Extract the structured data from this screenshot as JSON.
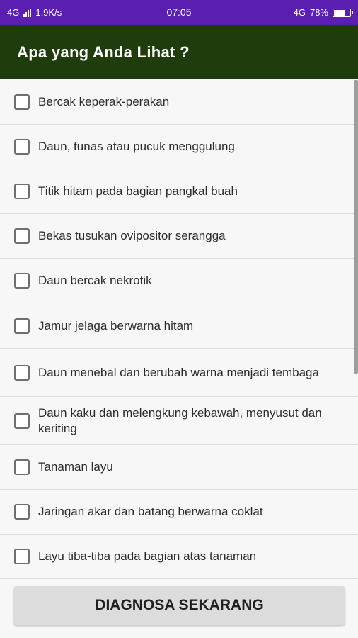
{
  "status_bar": {
    "network_left": "4G",
    "speed": "1,9K/s",
    "time": "07:05",
    "network_right": "4G",
    "battery": "78%",
    "battery_level": 0.78
  },
  "app_bar": {
    "title": "Apa yang Anda Lihat ?"
  },
  "options": [
    {
      "label": "Bercak keperak-perakan",
      "checked": false
    },
    {
      "label": "Daun, tunas atau pucuk menggulung",
      "checked": false
    },
    {
      "label": "Titik hitam pada bagian pangkal buah",
      "checked": false
    },
    {
      "label": "Bekas tusukan ovipositor serangga",
      "checked": false
    },
    {
      "label": "Daun bercak nekrotik",
      "checked": false
    },
    {
      "label": "Jamur jelaga berwarna hitam",
      "checked": false
    },
    {
      "label": "Daun menebal dan berubah warna menjadi tembaga",
      "checked": false
    },
    {
      "label": "Daun kaku dan melengkung kebawah, menyusut dan keriting",
      "checked": false
    },
    {
      "label": "Tanaman layu",
      "checked": false
    },
    {
      "label": "Jaringan akar dan batang berwarna coklat",
      "checked": false
    },
    {
      "label": "Layu tiba-tiba pada bagian atas tanaman",
      "checked": false
    }
  ],
  "button": {
    "label": "DIAGNOSA SEKARANG"
  },
  "colors": {
    "status_bar": "#5a1fb0",
    "app_bar": "#1f3d0c",
    "background": "#f7f7f7"
  }
}
